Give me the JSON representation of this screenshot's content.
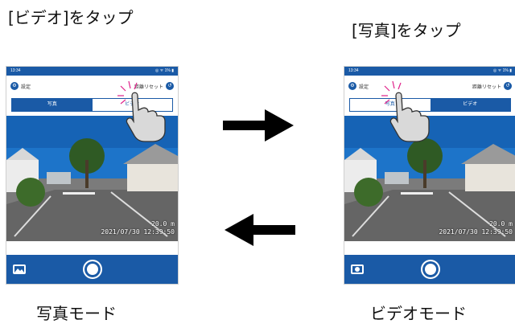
{
  "left": {
    "caption_top": "[ビデオ]をタップ",
    "caption_bottom": "写真モード",
    "status_time": "13:34",
    "status_right": "◎ ᯤ 1% ▮",
    "settings_label": "設定",
    "reset_label": "距離リセット",
    "tabs": [
      "写真",
      "ビデオ"
    ],
    "active_tab": 0,
    "distance": "20.0 m",
    "timestamp": "2021/07/30  12:39:50",
    "mode_icon": "gallery-icon"
  },
  "right": {
    "caption_top": "[写真]をタップ",
    "caption_bottom": "ビデオモード",
    "status_time": "13:34",
    "status_right": "◎ ᯤ 1% ▮",
    "settings_label": "設定",
    "reset_label": "距離リセット",
    "tabs": [
      "写真",
      "ビデオ"
    ],
    "active_tab": 1,
    "distance": "20.0 m",
    "timestamp": "2021/07/30  12:39:50",
    "mode_icon": "video-record-icon"
  },
  "colors": {
    "accent": "#1a5aa6",
    "arrow": "#000000",
    "tap_mark": "#e0218a"
  }
}
